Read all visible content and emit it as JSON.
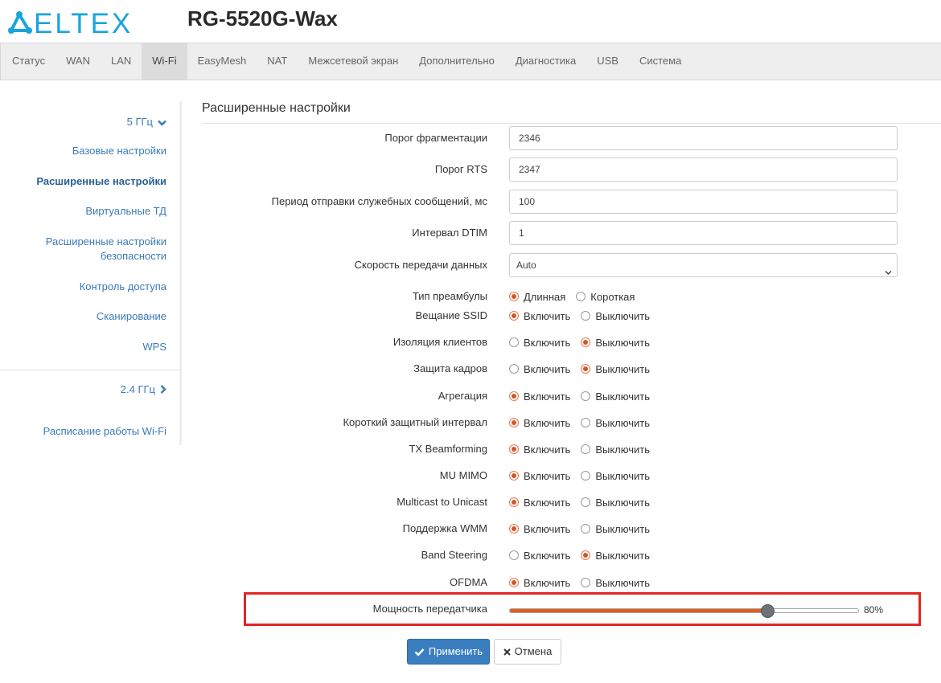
{
  "header": {
    "brand": "ELTEX",
    "device_title": "RG-5520G-Wax",
    "brand_color": "#1aa4dc"
  },
  "nav": {
    "tabs": [
      "Статус",
      "WAN",
      "LAN",
      "Wi-Fi",
      "EasyMesh",
      "NAT",
      "Межсетевой экран",
      "Дополнительно",
      "Диагностика",
      "USB",
      "Система"
    ],
    "active": "Wi-Fi"
  },
  "sidebar": {
    "band_5": "5 ГГц",
    "items": [
      "Базовые настройки",
      "Расширенные настройки",
      "Виртуальные ТД",
      "Расширенные настройки",
      "безопасности",
      "Контроль доступа",
      "Сканирование",
      "WPS"
    ],
    "band_24": "2.4 ГГц",
    "schedule": "Расписание работы Wi-Fi",
    "active": "Расширенные настройки"
  },
  "main": {
    "title": "Расширенные настройки",
    "fields": [
      {
        "label": "Порог фрагментации",
        "value": "2346"
      },
      {
        "label": "Порог RTS",
        "value": "2347"
      },
      {
        "label": "Период отправки служебных сообщений, мс",
        "value": "100"
      },
      {
        "label": "Интервал DTIM",
        "value": "1"
      }
    ],
    "rate": {
      "label": "Скорость передачи данных",
      "value": "Auto"
    },
    "preamble": {
      "label": "Тип преамбулы",
      "opt1": "Длинная",
      "opt2": "Короткая",
      "selected": 1
    },
    "on_label": "Включить",
    "off_label": "Выключить",
    "toggles": [
      {
        "label": "Вещание SSID",
        "selected": 1
      },
      {
        "label": "Изоляция клиентов",
        "selected": 2
      },
      {
        "label": "Защита кадров",
        "selected": 2
      },
      {
        "label": "Агрегация",
        "selected": 1
      },
      {
        "label": "Короткий защитный интервал",
        "selected": 1
      },
      {
        "label": "TX Beamforming",
        "selected": 1
      },
      {
        "label": "MU MIMO",
        "selected": 1
      },
      {
        "label": "Multicast to Unicast",
        "selected": 1
      },
      {
        "label": "Поддержка WMM",
        "selected": 1
      },
      {
        "label": "Band Steering",
        "selected": 2
      },
      {
        "label": "OFDMA",
        "selected": 1
      }
    ],
    "tx_power": {
      "label": "Мощность передатчика",
      "value_text": "80%",
      "fraction": 0.74
    },
    "apply_label": "Применить",
    "cancel_label": "Отмена",
    "accent_color": "#d8532a",
    "button_color": "#3a7ec0",
    "highlight_color": "#e32522"
  }
}
